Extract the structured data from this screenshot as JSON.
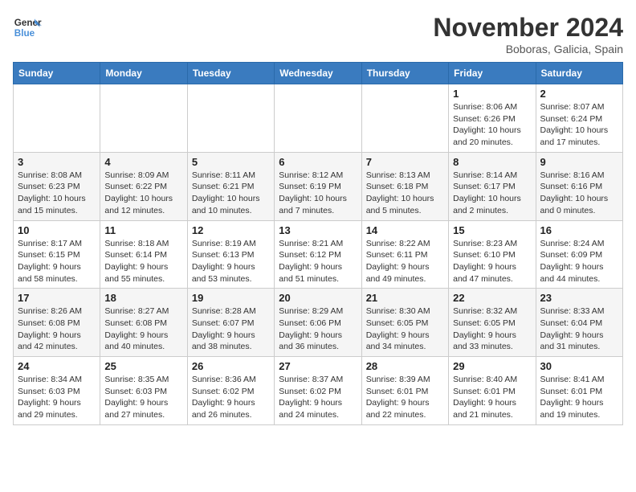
{
  "logo": {
    "line1": "General",
    "line2": "Blue"
  },
  "title": "November 2024",
  "subtitle": "Boboras, Galicia, Spain",
  "days_header": [
    "Sunday",
    "Monday",
    "Tuesday",
    "Wednesday",
    "Thursday",
    "Friday",
    "Saturday"
  ],
  "weeks": [
    [
      {
        "day": "",
        "info": ""
      },
      {
        "day": "",
        "info": ""
      },
      {
        "day": "",
        "info": ""
      },
      {
        "day": "",
        "info": ""
      },
      {
        "day": "",
        "info": ""
      },
      {
        "day": "1",
        "info": "Sunrise: 8:06 AM\nSunset: 6:26 PM\nDaylight: 10 hours and 20 minutes."
      },
      {
        "day": "2",
        "info": "Sunrise: 8:07 AM\nSunset: 6:24 PM\nDaylight: 10 hours and 17 minutes."
      }
    ],
    [
      {
        "day": "3",
        "info": "Sunrise: 8:08 AM\nSunset: 6:23 PM\nDaylight: 10 hours and 15 minutes."
      },
      {
        "day": "4",
        "info": "Sunrise: 8:09 AM\nSunset: 6:22 PM\nDaylight: 10 hours and 12 minutes."
      },
      {
        "day": "5",
        "info": "Sunrise: 8:11 AM\nSunset: 6:21 PM\nDaylight: 10 hours and 10 minutes."
      },
      {
        "day": "6",
        "info": "Sunrise: 8:12 AM\nSunset: 6:19 PM\nDaylight: 10 hours and 7 minutes."
      },
      {
        "day": "7",
        "info": "Sunrise: 8:13 AM\nSunset: 6:18 PM\nDaylight: 10 hours and 5 minutes."
      },
      {
        "day": "8",
        "info": "Sunrise: 8:14 AM\nSunset: 6:17 PM\nDaylight: 10 hours and 2 minutes."
      },
      {
        "day": "9",
        "info": "Sunrise: 8:16 AM\nSunset: 6:16 PM\nDaylight: 10 hours and 0 minutes."
      }
    ],
    [
      {
        "day": "10",
        "info": "Sunrise: 8:17 AM\nSunset: 6:15 PM\nDaylight: 9 hours and 58 minutes."
      },
      {
        "day": "11",
        "info": "Sunrise: 8:18 AM\nSunset: 6:14 PM\nDaylight: 9 hours and 55 minutes."
      },
      {
        "day": "12",
        "info": "Sunrise: 8:19 AM\nSunset: 6:13 PM\nDaylight: 9 hours and 53 minutes."
      },
      {
        "day": "13",
        "info": "Sunrise: 8:21 AM\nSunset: 6:12 PM\nDaylight: 9 hours and 51 minutes."
      },
      {
        "day": "14",
        "info": "Sunrise: 8:22 AM\nSunset: 6:11 PM\nDaylight: 9 hours and 49 minutes."
      },
      {
        "day": "15",
        "info": "Sunrise: 8:23 AM\nSunset: 6:10 PM\nDaylight: 9 hours and 47 minutes."
      },
      {
        "day": "16",
        "info": "Sunrise: 8:24 AM\nSunset: 6:09 PM\nDaylight: 9 hours and 44 minutes."
      }
    ],
    [
      {
        "day": "17",
        "info": "Sunrise: 8:26 AM\nSunset: 6:08 PM\nDaylight: 9 hours and 42 minutes."
      },
      {
        "day": "18",
        "info": "Sunrise: 8:27 AM\nSunset: 6:08 PM\nDaylight: 9 hours and 40 minutes."
      },
      {
        "day": "19",
        "info": "Sunrise: 8:28 AM\nSunset: 6:07 PM\nDaylight: 9 hours and 38 minutes."
      },
      {
        "day": "20",
        "info": "Sunrise: 8:29 AM\nSunset: 6:06 PM\nDaylight: 9 hours and 36 minutes."
      },
      {
        "day": "21",
        "info": "Sunrise: 8:30 AM\nSunset: 6:05 PM\nDaylight: 9 hours and 34 minutes."
      },
      {
        "day": "22",
        "info": "Sunrise: 8:32 AM\nSunset: 6:05 PM\nDaylight: 9 hours and 33 minutes."
      },
      {
        "day": "23",
        "info": "Sunrise: 8:33 AM\nSunset: 6:04 PM\nDaylight: 9 hours and 31 minutes."
      }
    ],
    [
      {
        "day": "24",
        "info": "Sunrise: 8:34 AM\nSunset: 6:03 PM\nDaylight: 9 hours and 29 minutes."
      },
      {
        "day": "25",
        "info": "Sunrise: 8:35 AM\nSunset: 6:03 PM\nDaylight: 9 hours and 27 minutes."
      },
      {
        "day": "26",
        "info": "Sunrise: 8:36 AM\nSunset: 6:02 PM\nDaylight: 9 hours and 26 minutes."
      },
      {
        "day": "27",
        "info": "Sunrise: 8:37 AM\nSunset: 6:02 PM\nDaylight: 9 hours and 24 minutes."
      },
      {
        "day": "28",
        "info": "Sunrise: 8:39 AM\nSunset: 6:01 PM\nDaylight: 9 hours and 22 minutes."
      },
      {
        "day": "29",
        "info": "Sunrise: 8:40 AM\nSunset: 6:01 PM\nDaylight: 9 hours and 21 minutes."
      },
      {
        "day": "30",
        "info": "Sunrise: 8:41 AM\nSunset: 6:01 PM\nDaylight: 9 hours and 19 minutes."
      }
    ]
  ]
}
